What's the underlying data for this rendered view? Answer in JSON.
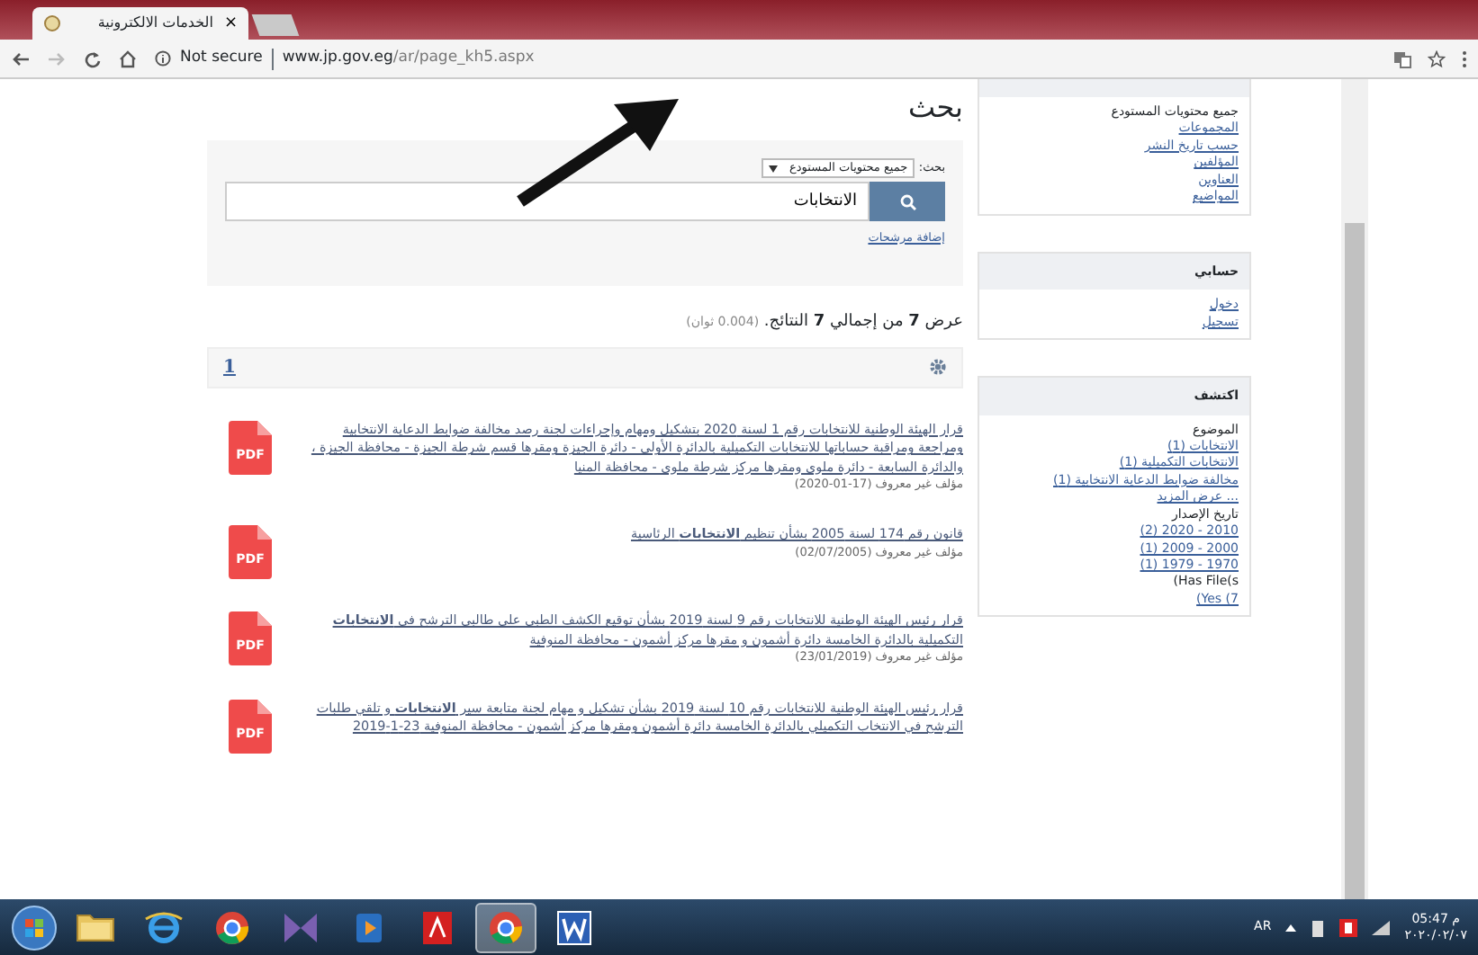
{
  "browser": {
    "tab": {
      "title": "الخدمات الالكترونية",
      "close": "×"
    },
    "security": "Not secure",
    "url": {
      "domain": "www.jp.gov.eg",
      "path": "/ar/page_kh5.aspx"
    }
  },
  "page_title": "بحث",
  "search": {
    "scope_label": "بحث:",
    "scope": "جميع محتويات المستودع",
    "query": "الانتخابات",
    "filters_link": "إضافة مرشحات"
  },
  "summary": {
    "text": "عرض **7** من إجمالي **7** النتائج.",
    "time": "(0.004 ثوان)"
  },
  "pagination": [
    {
      "label": "1",
      "selected": true
    }
  ],
  "results": [
    {
      "title": "قرار الهيئة الوطنية للانتخابات رقم 1 لسنة 2020 بتشكيل ومهام وإجراءات لجنة رصد مخالفة ضوابط الدعاية الانتخابية ومراجعة ومراقبة حساباتها للانتخابات التكميلية بالدائرة الأولى - دائرة الجيزة ومقرها قسم شرطة الجيزة - محافظة الجيزة ، والدائرة السابعة - دائرة ملوى ومقرها مركز شرطة ملوى - محافظة المنيا",
      "meta": "مؤلف غير معروف (17-01-2020)",
      "icon_label": "PDF"
    },
    {
      "title": "قانون رقم 174 لسنة 2005 بشأن تنظيم **الانتخابات** الرئاسية",
      "meta": "مؤلف غير معروف (02/07/2005)",
      "icon_label": "PDF"
    },
    {
      "title": "قرار رئيس الهيئة الوطنية للانتخابات رقم 9 لسنة 2019 بشأن توقيع الكشف الطبي على طالبي الترشح في **الانتخابات** التكميلية بالدائرة الخامسة دائرة أشمون و مقرها مركز أشمون - محافظة المنوفية",
      "meta": "مؤلف غير معروف (23/01/2019)",
      "icon_label": "PDF"
    },
    {
      "title": "قرار رئيس الهيئة الوطنية للانتخابات رقم 10 لسنة 2019 بشأن تشكيل و مهام لجنة متابعة سير **الانتخابات** و تلقي طلبات الترشح في الانتخاب التكميلي بالدائرة الخامسة دائرة أشمون ومقرها مركز أشمون - محافظة المنوفية 23-1-2019",
      "icon_label": "PDF"
    }
  ],
  "sidebar": [
    {
      "items": [
        {
          "kind": "text",
          "text": "جميع محتويات المستودع"
        },
        {
          "kind": "link",
          "text": "المجموعات"
        },
        {
          "kind": "link",
          "text": "حسب تاريخ النشر"
        },
        {
          "kind": "link",
          "text": "المؤلفين"
        },
        {
          "kind": "link",
          "text": "العناوين"
        },
        {
          "kind": "link",
          "text": "المواضيع"
        }
      ]
    },
    {
      "title": "حسابي",
      "items": [
        {
          "kind": "link",
          "text": "دخول"
        },
        {
          "kind": "link",
          "text": "تسجيل"
        }
      ]
    },
    {
      "title": "اكتشف",
      "items": [
        {
          "kind": "text",
          "text": "الموضوع"
        },
        {
          "kind": "link",
          "text": "الانتخابات (1)"
        },
        {
          "kind": "link",
          "text": "الانتخابات التكميلية (1)"
        },
        {
          "kind": "link",
          "text": "مخالفة ضوابط الدعاية الانتخابية (1)"
        },
        {
          "kind": "link",
          "text": "... عرض المزيد"
        },
        {
          "kind": "text",
          "text": "تاريخ الإصدار"
        },
        {
          "kind": "ltrlink",
          "text": "(2) 2020 - 2010"
        },
        {
          "kind": "ltrlink",
          "text": "(1) 2009 - 2000"
        },
        {
          "kind": "ltrlink",
          "text": "(1) 1979 - 1970"
        },
        {
          "kind": "ltrtext",
          "text": "(Has File(s"
        },
        {
          "kind": "ltrlink",
          "text": "(Yes (7"
        }
      ]
    }
  ],
  "taskbar": {
    "apps": [
      {
        "kind": "folder",
        "selected": false
      },
      {
        "kind": "ie",
        "selected": false
      },
      {
        "kind": "chrome",
        "selected": false
      },
      {
        "kind": "bowtie",
        "selected": false
      },
      {
        "kind": "media",
        "selected": false
      },
      {
        "kind": "pdf",
        "selected": false
      },
      {
        "kind": "chrome",
        "selected": true
      },
      {
        "kind": "word",
        "selected": false
      }
    ],
    "language": "AR",
    "time": "05:47 م",
    "date": "٢٠٢٠/٠٢/٠٧"
  }
}
